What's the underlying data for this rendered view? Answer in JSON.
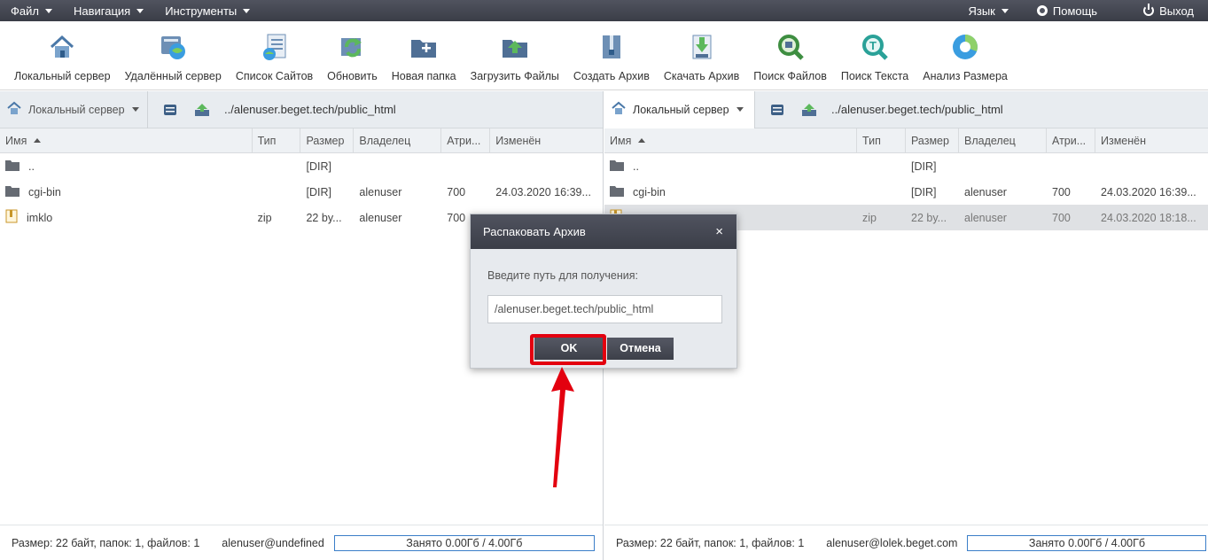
{
  "menu": {
    "file": "Файл",
    "navigation": "Навигация",
    "tools": "Инструменты",
    "language": "Язык",
    "help": "Помощь",
    "logout": "Выход"
  },
  "toolbar": [
    {
      "label": "Локальный сервер",
      "icon": "home-icon"
    },
    {
      "label": "Удалённый сервер",
      "icon": "remote-server-icon"
    },
    {
      "label": "Список Сайтов",
      "icon": "site-list-icon"
    },
    {
      "label": "Обновить",
      "icon": "refresh-icon"
    },
    {
      "label": "Новая папка",
      "icon": "new-folder-icon"
    },
    {
      "label": "Загрузить Файлы",
      "icon": "upload-icon"
    },
    {
      "label": "Создать Архив",
      "icon": "archive-icon"
    },
    {
      "label": "Скачать Архив",
      "icon": "download-archive-icon"
    },
    {
      "label": "Поиск Файлов",
      "icon": "search-files-icon"
    },
    {
      "label": "Поиск Текста",
      "icon": "search-text-icon"
    },
    {
      "label": "Анализ Размера",
      "icon": "size-analysis-icon"
    }
  ],
  "columns": {
    "name": "Имя",
    "type": "Тип",
    "size": "Размер",
    "owner": "Владелец",
    "attr": "Атри...",
    "modified": "Изменён"
  },
  "left": {
    "server": "Локальный сервер",
    "path": "../alenuser.beget.tech/public_html",
    "rows": [
      {
        "name": "..",
        "type": "",
        "size": "[DIR]",
        "owner": "",
        "attr": "",
        "modified": ""
      },
      {
        "name": "cgi-bin",
        "type": "",
        "size": "[DIR]",
        "owner": "alenuser",
        "attr": "700",
        "modified": "24.03.2020 16:39..."
      },
      {
        "name": "imklo",
        "type": "zip",
        "size": "22 by...",
        "owner": "alenuser",
        "attr": "700",
        "modified": ""
      }
    ],
    "status": "Размер: 22 байт, папок: 1, файлов: 1",
    "user": "alenuser@undefined",
    "quota": "Занято 0.00Гб / 4.00Гб"
  },
  "right": {
    "server": "Локальный сервер",
    "path": "../alenuser.beget.tech/public_html",
    "rows": [
      {
        "name": "..",
        "type": "",
        "size": "[DIR]",
        "owner": "",
        "attr": "",
        "modified": ""
      },
      {
        "name": "cgi-bin",
        "type": "",
        "size": "[DIR]",
        "owner": "alenuser",
        "attr": "700",
        "modified": "24.03.2020 16:39..."
      },
      {
        "name": "",
        "type": "zip",
        "size": "22 by...",
        "owner": "alenuser",
        "attr": "700",
        "modified": "24.03.2020 18:18..."
      }
    ],
    "status": "Размер: 22 байт, папок: 1, файлов: 1",
    "user": "alenuser@lolek.beget.com",
    "quota": "Занято 0.00Гб / 4.00Гб"
  },
  "dialog": {
    "title": "Распаковать Архив",
    "close": "×",
    "prompt": "Введите путь для получения:",
    "path_value": "/alenuser.beget.tech/public_html",
    "ok": "OK",
    "cancel": "Отмена"
  },
  "colors": {
    "accent_red": "#e3000f",
    "header_dark": "#3b3e48",
    "panel_bg": "#e8ecf0"
  }
}
